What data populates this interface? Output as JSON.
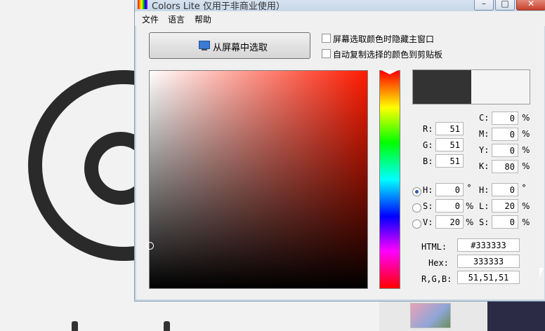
{
  "window": {
    "title": "Colors Lite 仅用于非商业使用）",
    "min": "–",
    "max": "□",
    "close": "✕"
  },
  "menu": [
    "文件",
    "语言",
    "帮助"
  ],
  "pick_button": "从屏幕中选取",
  "checkboxes": [
    {
      "label": "屏幕选取颜色时隐藏主窗口",
      "checked": false
    },
    {
      "label": "自动复制选择的颜色到剪贴板",
      "checked": false
    }
  ],
  "colors": {
    "current": "#333333",
    "previous": "#f4f4f4",
    "hue_marker_color": "#ffffff"
  },
  "rgb": {
    "r_label": "R:",
    "r": "51",
    "g_label": "G:",
    "g": "51",
    "b_label": "B:",
    "b": "51"
  },
  "cmyk": {
    "c_label": "C:",
    "c": "0",
    "m_label": "M:",
    "m": "0",
    "y_label": "Y:",
    "y": "0",
    "k_label": "K:",
    "k": "80",
    "unit": "%"
  },
  "hsv": {
    "h_label": "H:",
    "h": "0",
    "h_unit": "°",
    "s_label": "S:",
    "s": "0",
    "s_unit": "%",
    "v_label": "V:",
    "v": "20",
    "v_unit": "%",
    "selected": "H"
  },
  "hls": {
    "h_label": "H:",
    "h": "0",
    "h_unit": "°",
    "l_label": "L:",
    "l": "20",
    "l_unit": "%",
    "s_label": "S:",
    "s": "0",
    "s_unit": "%"
  },
  "codes": {
    "html_label": "HTML:",
    "html": "#333333",
    "hex_label": "Hex:",
    "hex": "333333",
    "rgb_label": "R,G,B:",
    "rgb": "51,51,51"
  }
}
